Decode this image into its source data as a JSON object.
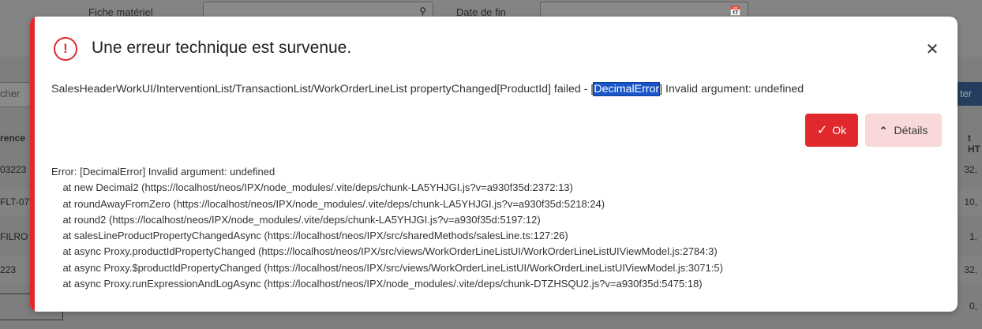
{
  "background": {
    "fields": [
      {
        "label": "Fiche matériel",
        "icon": "search-icon"
      },
      {
        "label": "Date de fin",
        "icon": "calendar-icon"
      }
    ],
    "search_fragment": "cher",
    "button_fragment": "ter",
    "column_left_fragment": "rence",
    "column_right_fragment": "t HT",
    "rows": [
      {
        "left": "03223",
        "right": "32,"
      },
      {
        "left": "FLT-07",
        "right": "10,"
      },
      {
        "left": "FILRO",
        "right": "1,"
      },
      {
        "left": "223",
        "right": "32,"
      },
      {
        "left": "",
        "right": "0,"
      }
    ]
  },
  "modal": {
    "title": "Une erreur technique est survenue.",
    "icon": "exclamation-circle-icon",
    "close_icon": "close-icon",
    "message_prefix": "SalesHeaderWorkUI/InterventionList/TransactionList/WorkOrderLineList propertyChanged[ProductId] failed - [",
    "message_highlight": "DecimalError",
    "message_suffix": "] Invalid argument: undefined",
    "ok_label": "Ok",
    "details_label": "Détails",
    "stack": [
      "Error: [DecimalError] Invalid argument: undefined",
      "    at new Decimal2 (https://localhost/neos/IPX/node_modules/.vite/deps/chunk-LA5YHJGI.js?v=a930f35d:2372:13)",
      "    at roundAwayFromZero (https://localhost/neos/IPX/node_modules/.vite/deps/chunk-LA5YHJGI.js?v=a930f35d:5218:24)",
      "    at round2 (https://localhost/neos/IPX/node_modules/.vite/deps/chunk-LA5YHJGI.js?v=a930f35d:5197:12)",
      "    at salesLineProductPropertyChangedAsync (https://localhost/neos/IPX/src/sharedMethods/salesLine.ts:127:26)",
      "    at async Proxy.productIdPropertyChanged (https://localhost/neos/IPX/src/views/WorkOrderLineListUI/WorkOrderLineListUIViewModel.js:2784:3)",
      "    at async Proxy.$productIdPropertyChanged (https://localhost/neos/IPX/src/views/WorkOrderLineListUI/WorkOrderLineListUIViewModel.js:3071:5)",
      "    at async Proxy.runExpressionAndLogAsync (https://localhost/neos/IPX/node_modules/.vite/deps/chunk-DTZHSQU2.js?v=a930f35d:5475:18)"
    ]
  },
  "colors": {
    "accent": "#e0282d",
    "details_bg": "#f8d8d8",
    "highlight": "#1a55c7"
  }
}
